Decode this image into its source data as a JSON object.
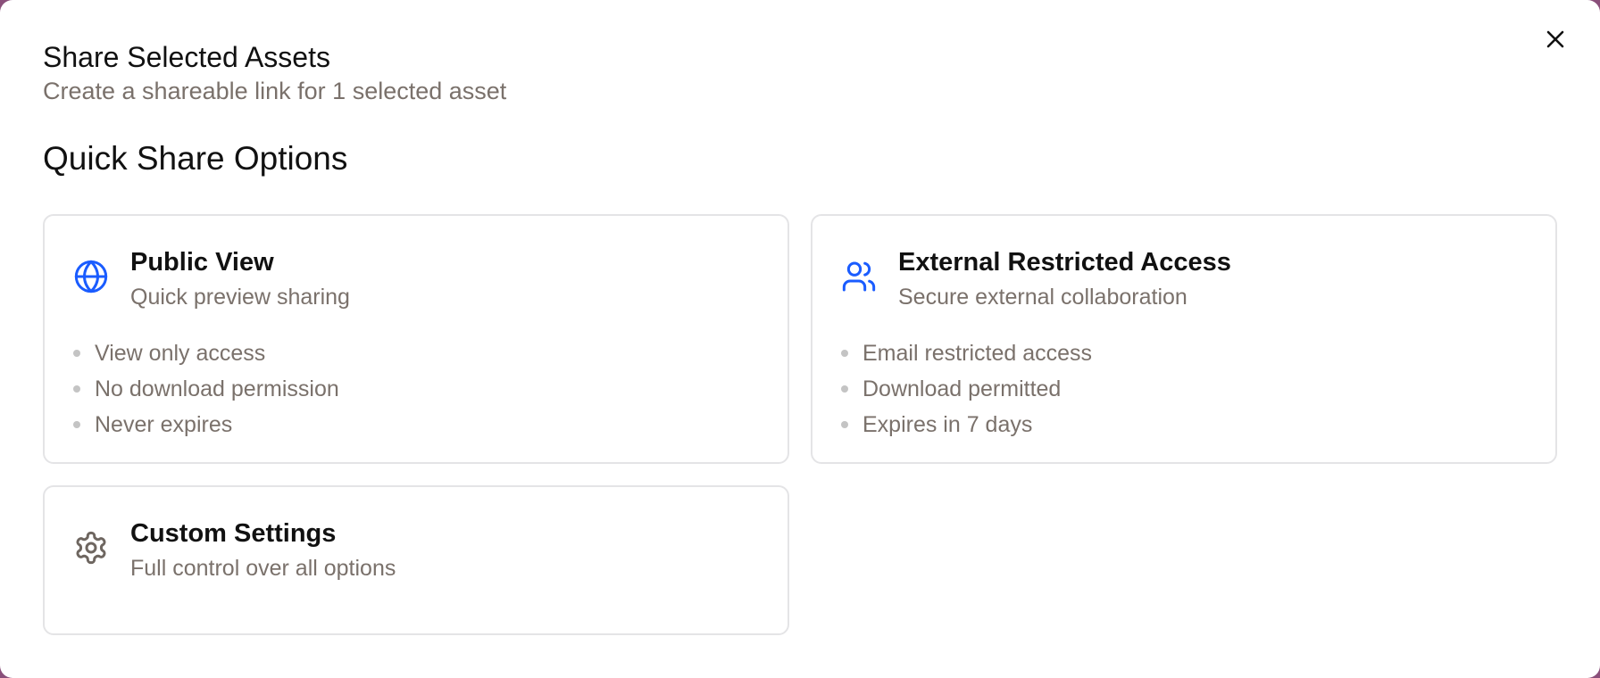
{
  "dialog": {
    "title": "Share Selected Assets",
    "subtitle": "Create a shareable link for 1 selected asset",
    "close_icon": "close-icon"
  },
  "quick_share": {
    "heading": "Quick Share Options",
    "options": [
      {
        "icon": "globe-icon",
        "icon_color": "#1a5cff",
        "title": "Public View",
        "description": "Quick preview sharing",
        "features": [
          "View only access",
          "No download permission",
          "Never expires"
        ]
      },
      {
        "icon": "users-icon",
        "icon_color": "#1a5cff",
        "title": "External Restricted Access",
        "description": "Secure external collaboration",
        "features": [
          "Email restricted access",
          "Download permitted",
          "Expires in 7 days"
        ]
      },
      {
        "icon": "gear-icon",
        "icon_color": "#6e6660",
        "title": "Custom Settings",
        "description": "Full control over all options",
        "features": []
      }
    ]
  },
  "colors": {
    "accent": "#1a5cff",
    "muted_text": "#7a716b",
    "border": "#e4e4e6"
  }
}
